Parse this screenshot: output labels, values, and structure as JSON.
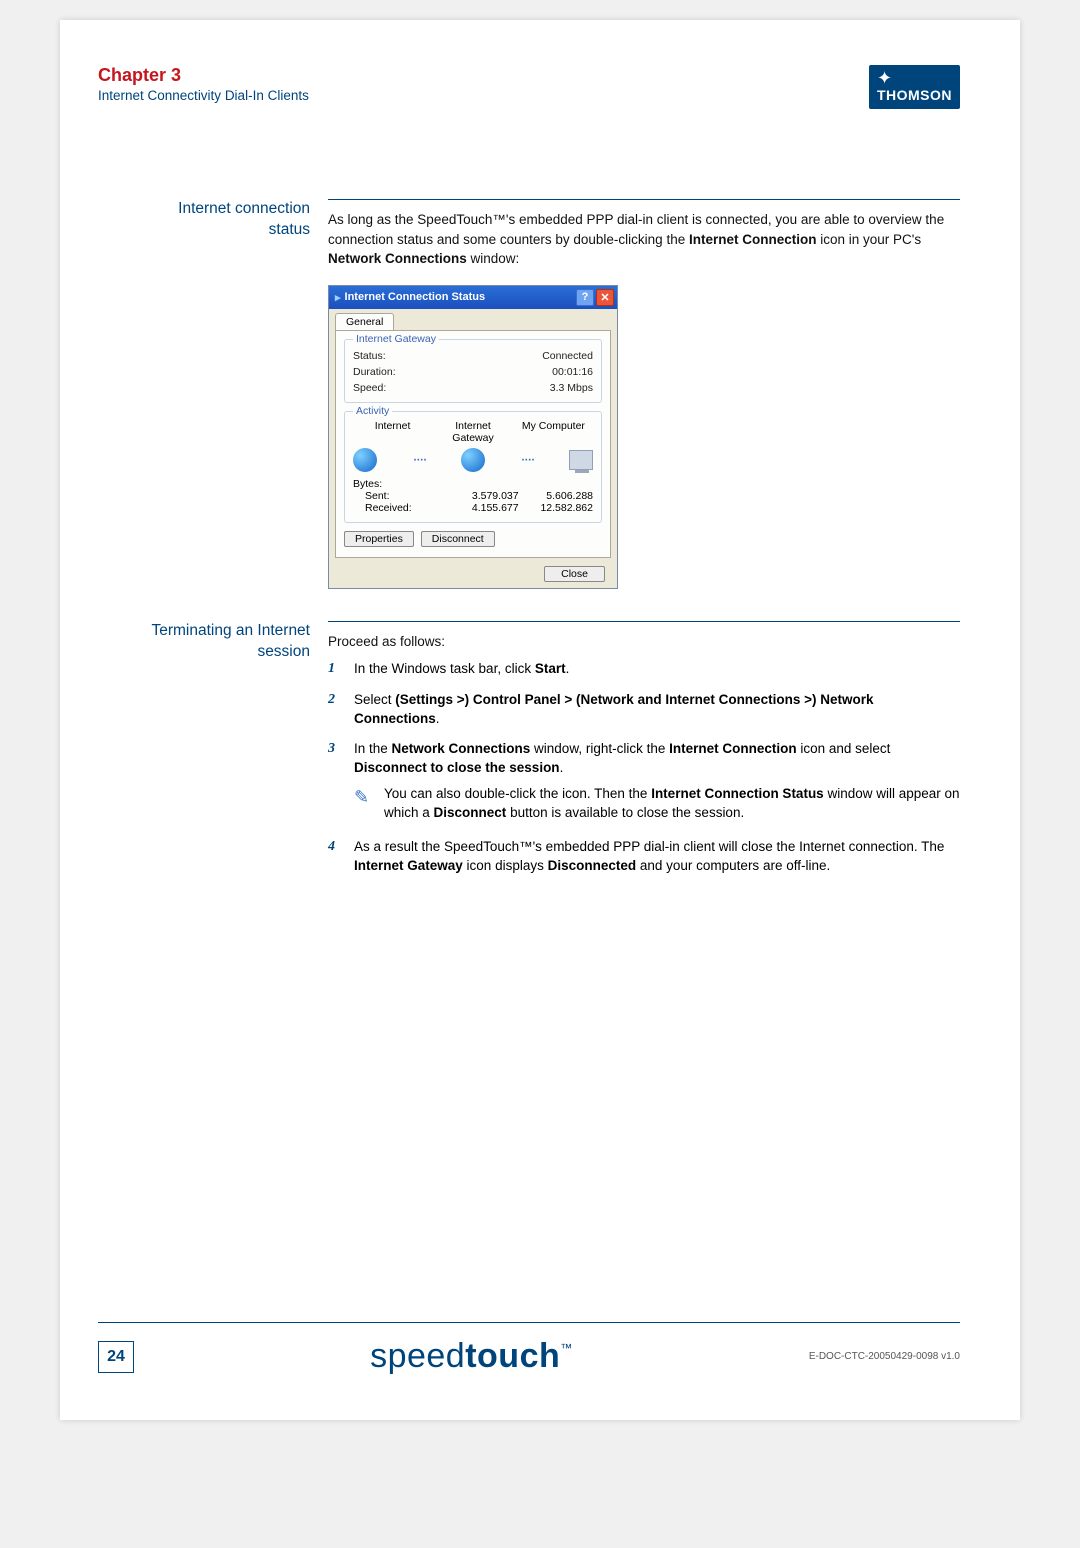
{
  "header": {
    "chapter": "Chapter 3",
    "subtitle": "Internet Connectivity Dial-In Clients",
    "logo_text": "THOMSON"
  },
  "section1": {
    "label_line1": "Internet connection",
    "label_line2": "status",
    "para_a": "As long as the SpeedTouch™'s embedded PPP dial-in client is connected, you are able to overview the connection status and some counters by double-clicking the ",
    "para_b": "Internet Connection",
    "para_c": " icon in your PC's ",
    "para_d": "Network Connections",
    "para_e": " window:"
  },
  "dialog": {
    "title": "Internet Connection Status",
    "tab": "General",
    "group1": "Internet Gateway",
    "status_lbl": "Status:",
    "status_val": "Connected",
    "duration_lbl": "Duration:",
    "duration_val": "00:01:16",
    "speed_lbl": "Speed:",
    "speed_val": "3.3 Mbps",
    "group2": "Activity",
    "col1": "Internet",
    "col2": "Internet Gateway",
    "col3": "My Computer",
    "bytes_lbl": "Bytes:",
    "sent_lbl": "Sent:",
    "sent_v1": "3.579.037",
    "sent_v2": "5.606.288",
    "recv_lbl": "Received:",
    "recv_v1": "4.155.677",
    "recv_v2": "12.582.862",
    "btn_props": "Properties",
    "btn_disc": "Disconnect",
    "btn_close": "Close"
  },
  "section2": {
    "label_line1": "Terminating an Internet",
    "label_line2": "session",
    "intro": "Proceed as follows:",
    "s1_a": "In the Windows task bar, click ",
    "s1_b": "Start",
    "s1_c": ".",
    "s2_a": "Select ",
    "s2_b": "(Settings >) Control Panel > (Network and Internet Connections >) Network Connections",
    "s2_c": ".",
    "s3_a": "In the ",
    "s3_b": "Network Connections",
    "s3_c": " window, right-click the ",
    "s3_d": "Internet Connection",
    "s3_e": " icon and select ",
    "s3_f": "Disconnect to close the session",
    "s3_g": ".",
    "note_a": "You can also double-click the icon. Then the ",
    "note_b": "Internet Connection Status",
    "note_c": " window will appear on which a ",
    "note_d": "Disconnect",
    "note_e": " button is available to close the session.",
    "s4_a": "As a result the SpeedTouch™'s embedded PPP dial-in client will close the Internet connection. The ",
    "s4_b": "Internet Gateway",
    "s4_c": " icon displays ",
    "s4_d": "Disconnected",
    "s4_e": " and your computers are off-line."
  },
  "footer": {
    "page_num": "24",
    "brand_thin": "speed",
    "brand_bold": "touch",
    "doc_id": "E-DOC-CTC-20050429-0098 v1.0"
  },
  "nums": {
    "n1": "1",
    "n2": "2",
    "n3": "3",
    "n4": "4"
  }
}
